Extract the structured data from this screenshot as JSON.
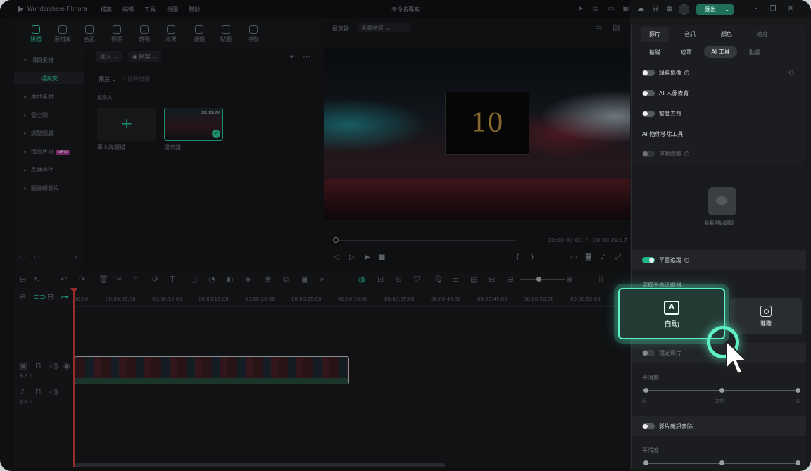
{
  "app": {
    "name": "Wondershare Filmora",
    "project_title": "未命名專案",
    "export_label": "匯出"
  },
  "menu": [
    "檔案",
    "編輯",
    "工具",
    "視圖",
    "幫助"
  ],
  "tool_tabs": [
    "媒體",
    "素材庫",
    "音訊",
    "標題",
    "轉場",
    "效果",
    "濾鏡",
    "貼圖",
    "模板"
  ],
  "tree": {
    "items": [
      "項目素材",
      "檔案夾",
      "本地素材",
      "雲空間",
      "調整圖層",
      "復合片段",
      "品牌套件",
      "圖像轉影片"
    ],
    "new_badge": "NEW"
  },
  "media": {
    "import_label": "匯入",
    "sort_label": "頻製",
    "filter_label": "預設",
    "search_placeholder": "搜尋媒體",
    "folder_label": "檔案夾",
    "import_tile_label": "導入媒體檔",
    "clip_name": "還去誰",
    "clip_duration": "00:00:29"
  },
  "preview": {
    "player_label": "播放器",
    "quality": "素高品質",
    "time_current": "00:00:00:00",
    "time_sep": "/",
    "time_total": "00:00:29:17",
    "countdown": "10"
  },
  "timeline": {
    "ticks": [
      "00:00",
      "00:00:05:00",
      "00:00:10:00",
      "00:00:15:00",
      "00:00:20:00",
      "00:00:25:00",
      "00:00:30:00",
      "00:00:35:00",
      "00:00:40:00",
      "00:00:45:00",
      "00:00:50:00",
      "00:00:55:00"
    ],
    "video_track": "影片 1",
    "audio_track": "音訊 1"
  },
  "panel": {
    "tabs": [
      "影片",
      "音訊",
      "顏色",
      "速度"
    ],
    "subtabs": [
      "基礎",
      "遮罩",
      "AI 工具",
      "動畫"
    ],
    "rows": {
      "green_screen": "綠幕摳像",
      "ai_portrait": "AI 人像去背",
      "smart_cutout": "智慧去背",
      "object_remove": "AI 物件移除工具",
      "motion_track": "運動跟蹤",
      "track_hint": "點擊開始跟蹤",
      "stabilize": "平面追蹤",
      "choose_tracker": "選取平面追蹤器",
      "stabilize_video": "穩定影片",
      "smoothness": "平滑度",
      "level_low": "弱",
      "level_mid": "正常",
      "level_high": "強",
      "denoise": "影片雜訊去除",
      "smoothness2": "平滑度"
    },
    "auto_label": "自動",
    "advanced_label": "進階"
  },
  "colors": {
    "accent": "#2fd1a2",
    "highlight": "#5ff1c6",
    "export": "#1f6f5b"
  }
}
